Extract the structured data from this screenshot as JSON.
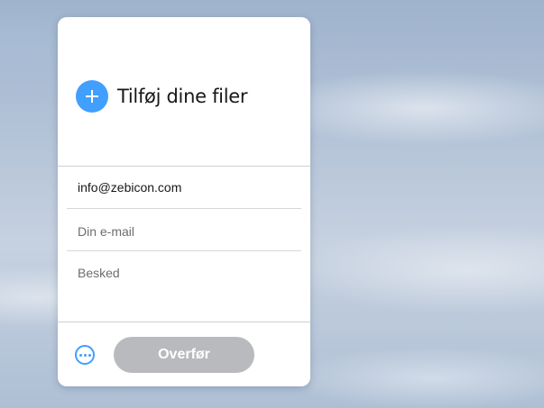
{
  "upload": {
    "add_files_label": "Tilføj dine filer",
    "add_icon": "plus-icon"
  },
  "form": {
    "recipient_value": "info@zebicon.com",
    "sender_placeholder": "Din e-mail",
    "message_placeholder": "Besked"
  },
  "actions": {
    "more_icon": "more-options-icon",
    "transfer_label": "Overfør"
  },
  "colors": {
    "accent": "#409fff",
    "transfer_disabled": "#b9babd",
    "card_background": "#ffffff"
  }
}
